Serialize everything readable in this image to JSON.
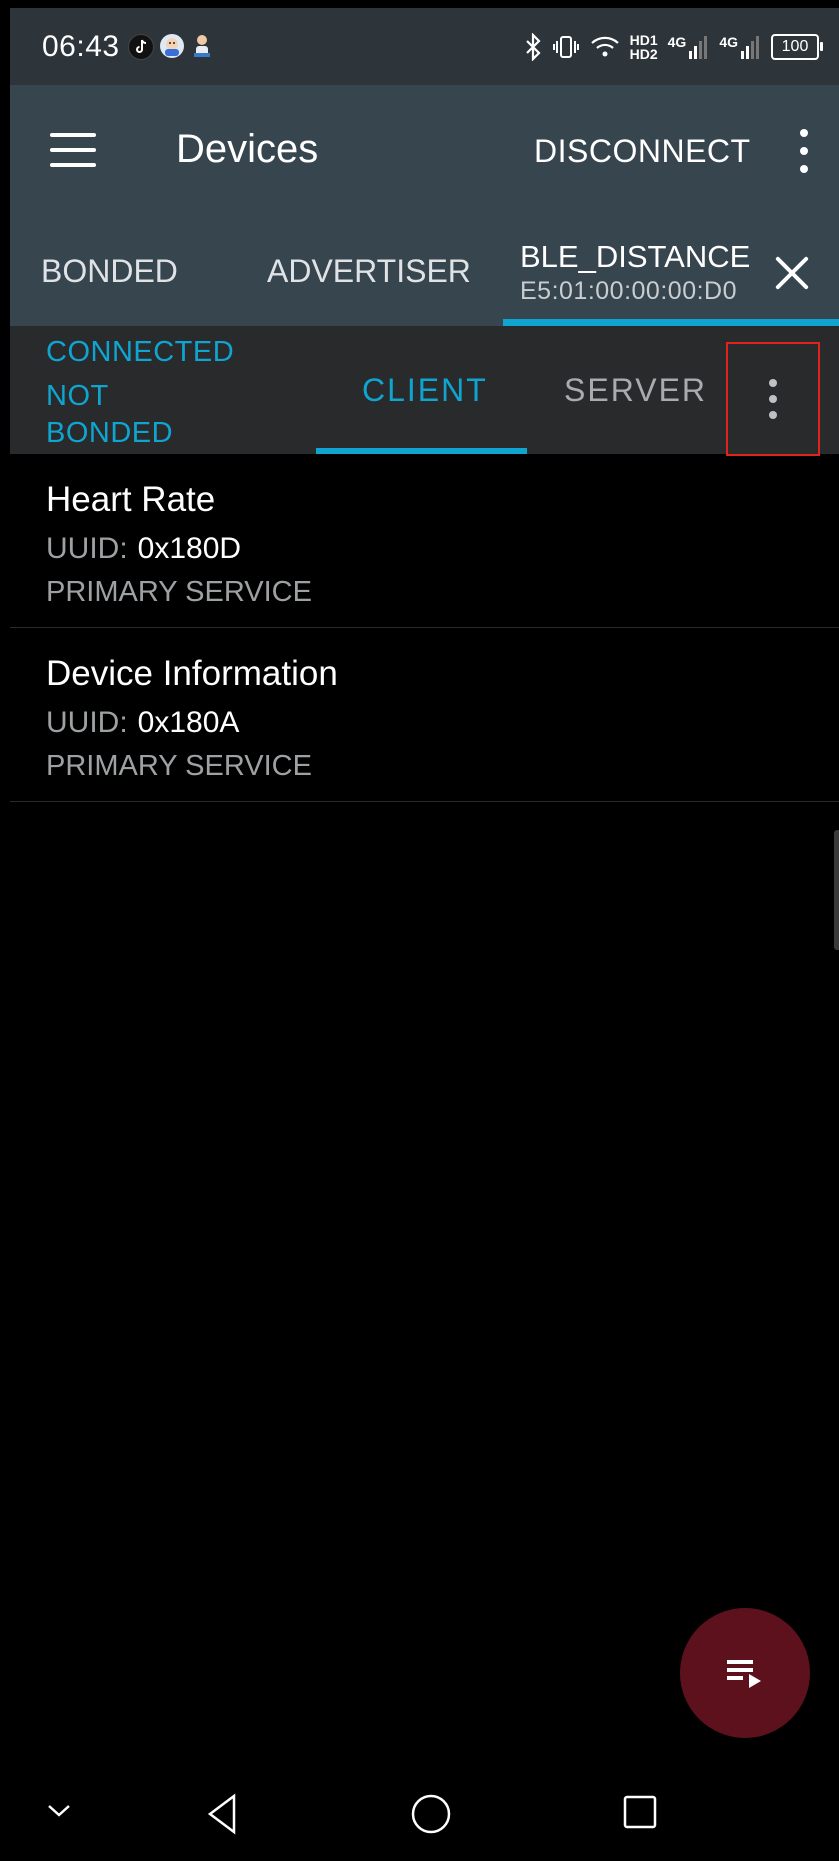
{
  "status_bar": {
    "time": "06:43",
    "hd_top": "HD1",
    "hd_bottom": "HD2",
    "net1": "4G",
    "net2": "4G",
    "battery": "100"
  },
  "app_bar": {
    "title": "Devices",
    "disconnect_label": "DISCONNECT"
  },
  "device_tabs": {
    "bonded": "BONDED",
    "advertiser": "ADVERTISER",
    "device_name": "BLE_DISTANCE",
    "device_mac": "E5:01:00:00:00:D0"
  },
  "client_bar": {
    "state_connected": "CONNECTED",
    "state_bond": "NOT BONDED",
    "tab_client": "CLIENT",
    "tab_server": "SERVER"
  },
  "services": [
    {
      "name": "Heart Rate",
      "uuid_label": "UUID:",
      "uuid": "0x180D",
      "type": "PRIMARY SERVICE"
    },
    {
      "name": "Device Information",
      "uuid_label": "UUID:",
      "uuid": "0x180A",
      "type": "PRIMARY SERVICE"
    }
  ],
  "colors": {
    "accent": "#0fa5d0",
    "app_bar": "#37454f",
    "fab": "#5c111d",
    "highlight": "#e0241b"
  },
  "icons": {
    "menu": "menu-icon",
    "overflow": "more-vert-icon",
    "close": "close-icon",
    "fab": "playlist-play-icon"
  }
}
